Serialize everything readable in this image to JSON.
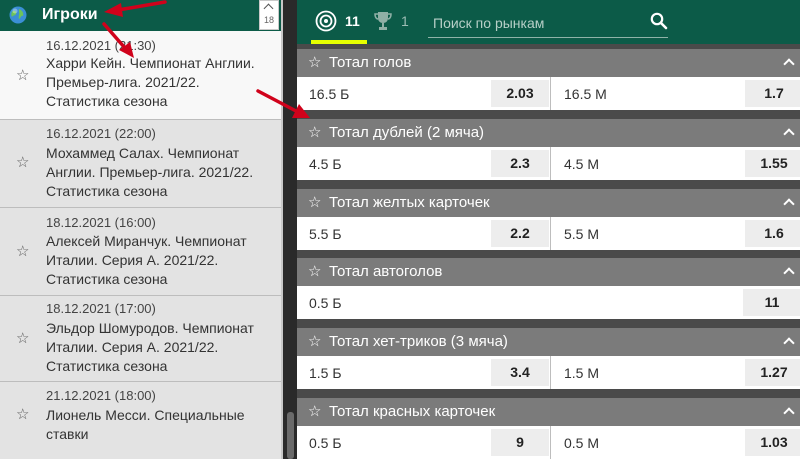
{
  "left_panel": {
    "title": "Игроки",
    "count": "18",
    "items": [
      {
        "date": "16.12.2021 (21:30)",
        "title": "Харри Кейн. Чемпионат Англии. Премьер-лига. 2021/22. Статистика сезона"
      },
      {
        "date": "16.12.2021 (22:00)",
        "title": "Мохаммед Салах. Чемпионат Англии. Премьер-лига. 2021/22. Статистика сезона"
      },
      {
        "date": "18.12.2021 (16:00)",
        "title": "Алексей Миранчук. Чемпионат Италии. Серия А. 2021/22. Статистика сезона"
      },
      {
        "date": "18.12.2021 (17:00)",
        "title": "Эльдор Шомуродов. Чемпионат Италии. Серия А. 2021/22. Статистика сезона"
      },
      {
        "date": "21.12.2021 (18:00)",
        "title": "Лионель Месси. Специальные ставки"
      }
    ]
  },
  "header": {
    "markets_count": "11",
    "trophy_count": "1",
    "search_placeholder": "Поиск по рынкам"
  },
  "markets": [
    {
      "name": "Тотал голов",
      "outcomes": [
        {
          "label": "16.5 Б",
          "odd": "2.03"
        },
        {
          "label": "16.5 М",
          "odd": "1.7"
        }
      ]
    },
    {
      "name": "Тотал дублей (2 мяча)",
      "outcomes": [
        {
          "label": "4.5 Б",
          "odd": "2.3"
        },
        {
          "label": "4.5 М",
          "odd": "1.55"
        }
      ]
    },
    {
      "name": "Тотал желтых карточек",
      "outcomes": [
        {
          "label": "5.5 Б",
          "odd": "2.2"
        },
        {
          "label": "5.5 М",
          "odd": "1.6"
        }
      ]
    },
    {
      "name": "Тотал автоголов",
      "outcomes": [
        {
          "label": "0.5 Б",
          "odd": "11"
        }
      ]
    },
    {
      "name": "Тотал хет-триков (3 мяча)",
      "outcomes": [
        {
          "label": "1.5 Б",
          "odd": "3.4"
        },
        {
          "label": "1.5 М",
          "odd": "1.27"
        }
      ]
    },
    {
      "name": "Тотал красных карточек",
      "outcomes": [
        {
          "label": "0.5 Б",
          "odd": "9"
        },
        {
          "label": "0.5 М",
          "odd": "1.03"
        }
      ]
    }
  ],
  "colors": {
    "header_green": "#0c5b48",
    "accent_yellow": "#e6ff00",
    "market_header_gray": "#7b7b7b",
    "arrow_red": "#d0021b"
  }
}
